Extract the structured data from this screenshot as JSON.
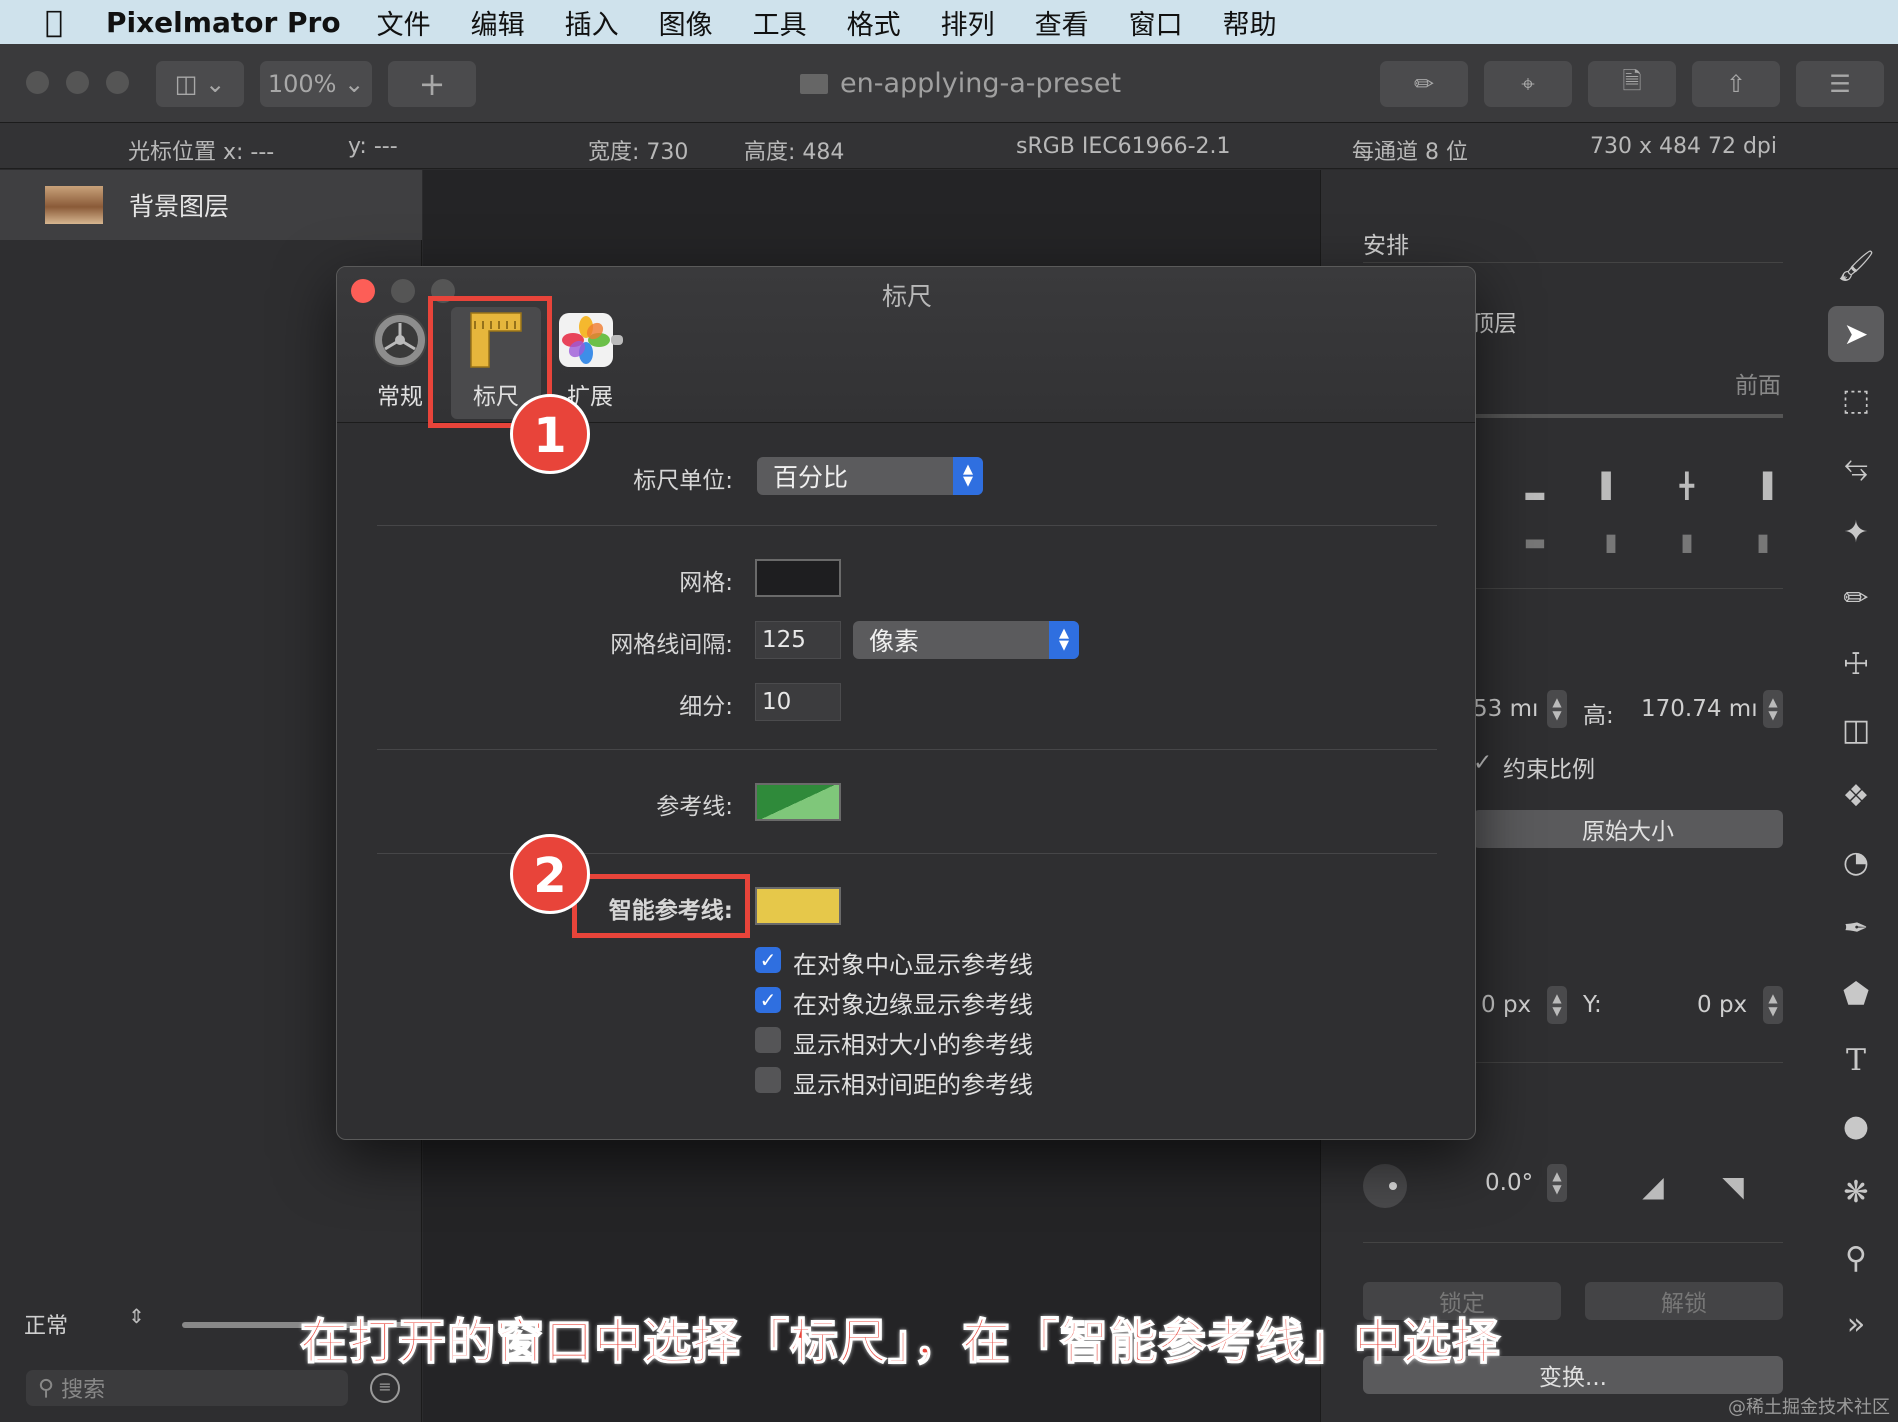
{
  "menubar": {
    "app_name": "Pixelmator Pro",
    "items": [
      "文件",
      "编辑",
      "插入",
      "图像",
      "工具",
      "格式",
      "排列",
      "查看",
      "窗口",
      "帮助"
    ]
  },
  "toolbar": {
    "zoom": "100%",
    "add_label": "+",
    "document_title": "en-applying-a-preset"
  },
  "infobar": {
    "cursor_x": "光标位置 x: ---",
    "cursor_y": "y: ---",
    "width": "宽度: 730",
    "height": "高度: 484",
    "color_profile": "sRGB IEC61966-2.1",
    "bit_depth": "每通道 8 位",
    "resolution": "730 x 484 72 dpi"
  },
  "layers": {
    "layer_name": "背景图层",
    "blend_mode": "正常",
    "search_placeholder": "搜索"
  },
  "right_panel": {
    "section_title": "安排",
    "layer_order": "顶层",
    "front_label": "前面",
    "width_value": "53 mı",
    "height_label": "高:",
    "height_value": "170.74 mı",
    "constrain_label": "约束比例",
    "original_size_button": "原始大小",
    "x_value": "0 px",
    "y_label": "Y:",
    "y_value": "0 px",
    "rotation_value": "0.0°",
    "lock_button": "锁定",
    "unlock_button": "解锁",
    "transform_button": "变换..."
  },
  "dialog": {
    "title": "标尺",
    "tabs": [
      {
        "label": "常规",
        "icon": "gear-icon"
      },
      {
        "label": "标尺",
        "icon": "ruler-icon"
      },
      {
        "label": "扩展",
        "icon": "photos-extension-icon"
      }
    ],
    "ruler_units_label": "标尺单位:",
    "ruler_units_value": "百分比",
    "grid_label": "网格:",
    "grid_color": "#1e1e20",
    "grid_spacing_label": "网格线间隔:",
    "grid_spacing_value": "125",
    "grid_spacing_unit": "像素",
    "subdivisions_label": "细分:",
    "subdivisions_value": "10",
    "guides_label": "参考线:",
    "guides_color": "#2f8a3a",
    "smart_guides_label": "智能参考线:",
    "smart_guides_color": "#e6c84a",
    "options": [
      {
        "label": "在对象中心显示参考线",
        "checked": true
      },
      {
        "label": "在对象边缘显示参考线",
        "checked": true
      },
      {
        "label": "显示相对大小的参考线",
        "checked": false
      },
      {
        "label": "显示相对间距的参考线",
        "checked": false
      }
    ]
  },
  "annotations": {
    "badge1": "1",
    "badge2": "2",
    "caption": "在打开的窗口中选择「标尺」，在「智能参考线」中选择",
    "highlight_color": "#e8443a"
  },
  "watermark": "@稀土掘金技术社区"
}
